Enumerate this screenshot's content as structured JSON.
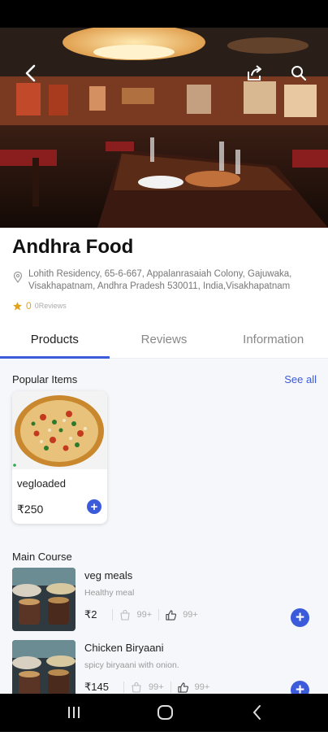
{
  "header": {
    "icons": [
      "back-arrow-icon",
      "share-icon",
      "search-icon"
    ]
  },
  "restaurant": {
    "name": "Andhra Food",
    "address_line1": "Lohith Residency, 65-6-667, Appalanrasaiah Colony, Gajuwaka,",
    "address_line2": "Visakhapatnam, Andhra Pradesh 530011, India,Visakhapatnam",
    "rating": "0",
    "reviews_label": "0Reviews"
  },
  "tabs": [
    {
      "label": "Products",
      "active": true
    },
    {
      "label": "Reviews",
      "active": false
    },
    {
      "label": "Information",
      "active": false
    }
  ],
  "popular": {
    "title": "Popular Items",
    "see_all": "See all",
    "items": [
      {
        "name": "vegloaded",
        "price": "₹250"
      }
    ]
  },
  "main_course": {
    "title": "Main Course",
    "items": [
      {
        "name": "veg meals",
        "desc": "Healthy meal",
        "price": "₹2",
        "count1": "99+",
        "count2": "99+"
      },
      {
        "name": "Chicken Biryaani",
        "desc": "spicy biryaani with onion.",
        "price": "₹145",
        "count1": "99+",
        "count2": "99+"
      }
    ]
  },
  "colors": {
    "accent": "#3b5bdb",
    "star": "#e3a21a"
  }
}
